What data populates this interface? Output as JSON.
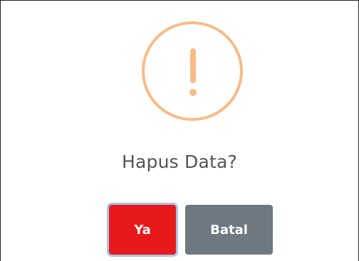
{
  "dialog": {
    "title": "Hapus Data?",
    "icon": "warning-exclamation-icon",
    "icon_color": "#f8bb86",
    "confirm_label": "Ya",
    "confirm_color": "#e8191b",
    "cancel_label": "Batal",
    "cancel_color": "#6e7881"
  }
}
